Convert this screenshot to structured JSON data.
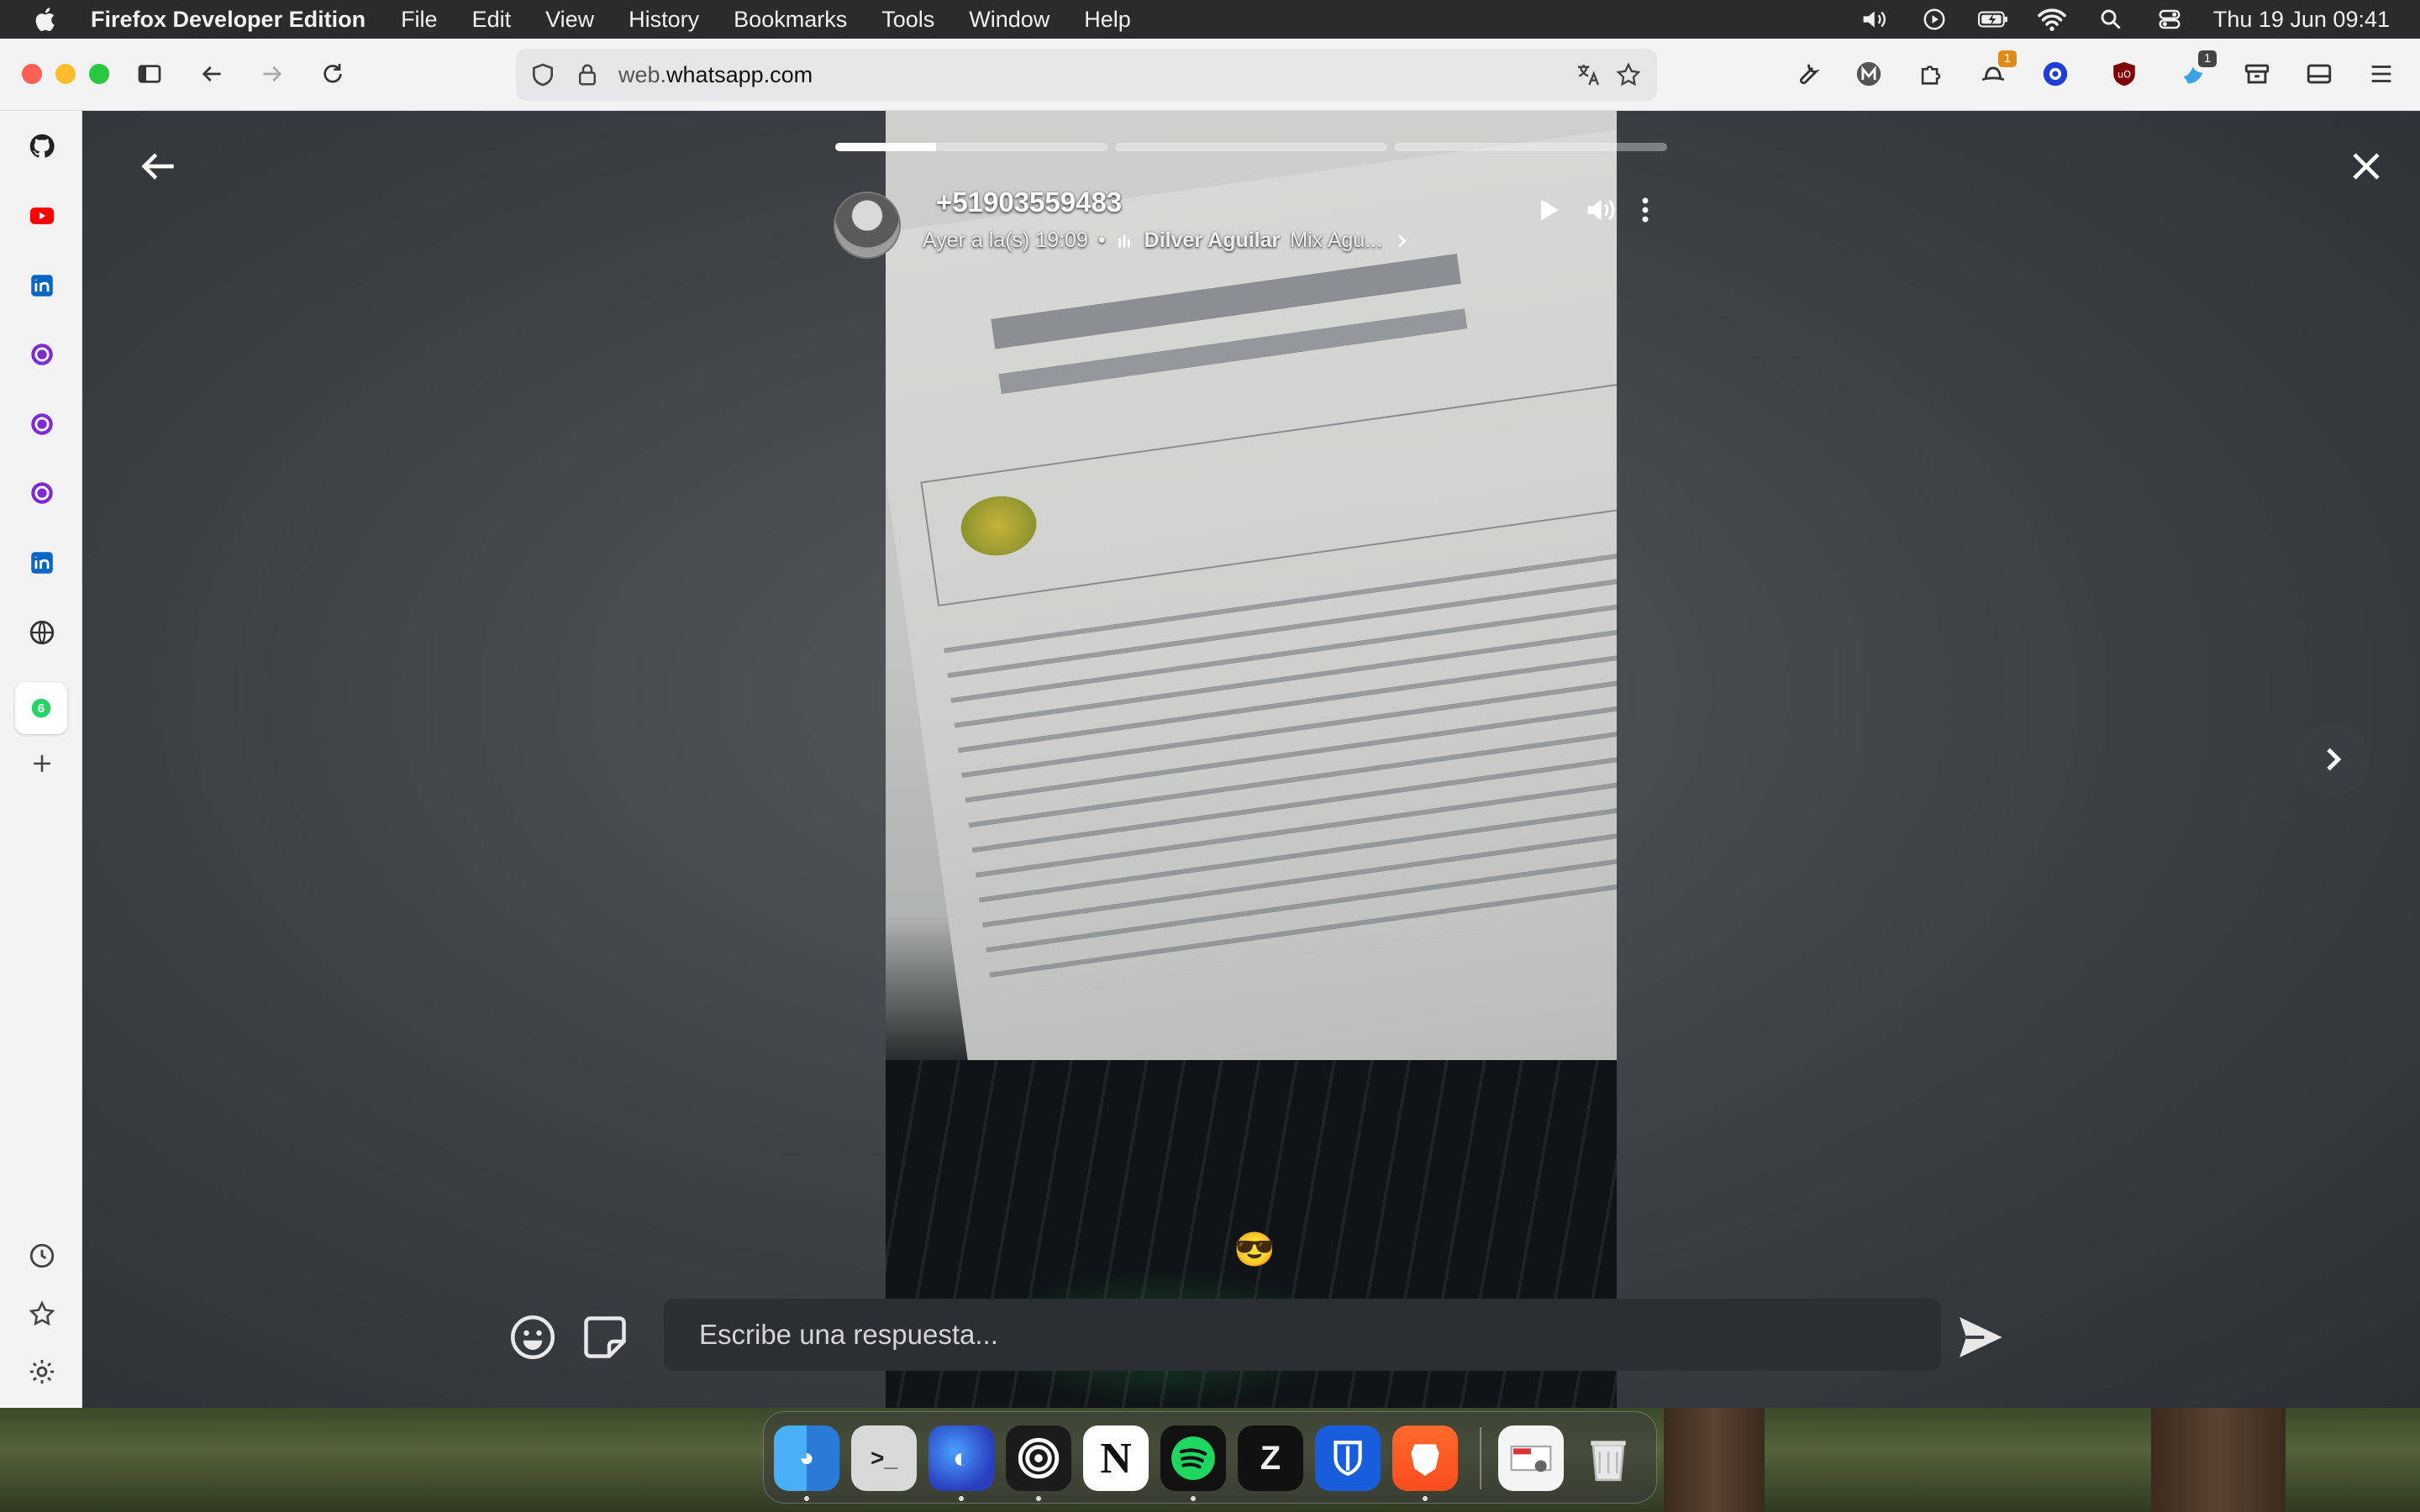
{
  "menubar": {
    "app_name": "Firefox Developer Edition",
    "menus": [
      "File",
      "Edit",
      "View",
      "History",
      "Bookmarks",
      "Tools",
      "Window",
      "Help"
    ],
    "datetime": "Thu 19 Jun  09:41"
  },
  "browser": {
    "url_host": "web.",
    "url_domain": "whatsapp.com",
    "extension_badges": {
      "ext_4": "1",
      "ext_7": "1"
    },
    "colors": {
      "toolbar_bg": "#f3f3f4",
      "urlbar_bg": "#e6e6e8",
      "accent": "#0a84ff"
    }
  },
  "sidebar": {
    "items": [
      "github-icon",
      "youtube-icon",
      "linkedin-icon",
      "tor-icon",
      "tor-icon",
      "tor-icon",
      "linkedin-icon",
      "globe-icon",
      "whatsapp-icon",
      "add-icon"
    ],
    "whatsapp_badge": "6",
    "bottom_items": [
      "history-icon",
      "bookmarks-icon",
      "settings-icon"
    ]
  },
  "status_viewer": {
    "contact": "+51903559483",
    "timestamp": "Ayer a la(s) 19:09",
    "music": {
      "title": "Dilver Aguilar",
      "artist": "Mix Agu..."
    },
    "progress_segments": 3,
    "current_segment_progress": 0.37,
    "caption_emoji": "😎",
    "reply_placeholder": "Escribe una respuesta..."
  },
  "dock": {
    "apps": [
      "finder-icon",
      "terminal-icon",
      "firefox-icon",
      "podcast-icon",
      "notion-icon",
      "spotify-icon",
      "zed-icon",
      "bitwarden-icon",
      "brave-icon",
      "preview-icon",
      "trash-icon"
    ]
  }
}
